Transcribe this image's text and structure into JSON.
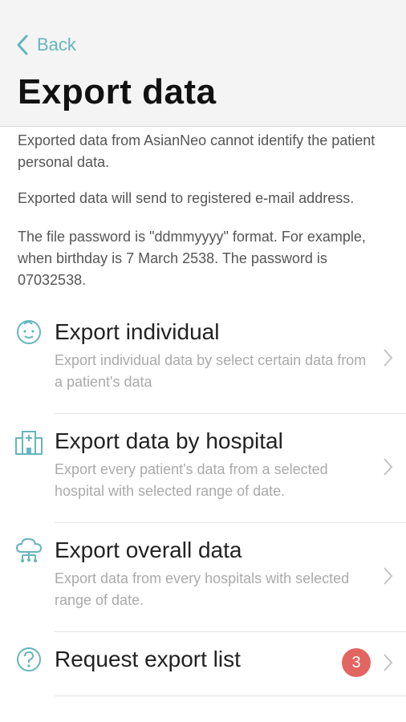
{
  "nav": {
    "back_label": "Back"
  },
  "page": {
    "title": "Export data"
  },
  "info": {
    "line1": "Exported data from AsianNeo cannot identify the patient personal data.",
    "line2": "Exported data will send to registered e-mail address.",
    "line3": "The file password is \"ddmmyyyy\" format. For example, when birthday is 7 March 2538. The password is 07032538."
  },
  "menu": [
    {
      "title": "Export individual",
      "description": "Export individual data by select certain data from a patient's data",
      "icon": "baby-face-icon"
    },
    {
      "title": "Export data by hospital",
      "description": "Export every patient's data from a selected hospital with selected range of date.",
      "icon": "hospital-icon"
    },
    {
      "title": "Export overall data",
      "description": "Export data from every hospitals with selected range of date.",
      "icon": "cloud-network-icon"
    },
    {
      "title": "Request export list",
      "badge": "3",
      "icon": "question-circle-icon"
    }
  ],
  "colors": {
    "accent": "#66b5bf",
    "badge": "#e26561",
    "header_bg": "#f4f4f4"
  }
}
